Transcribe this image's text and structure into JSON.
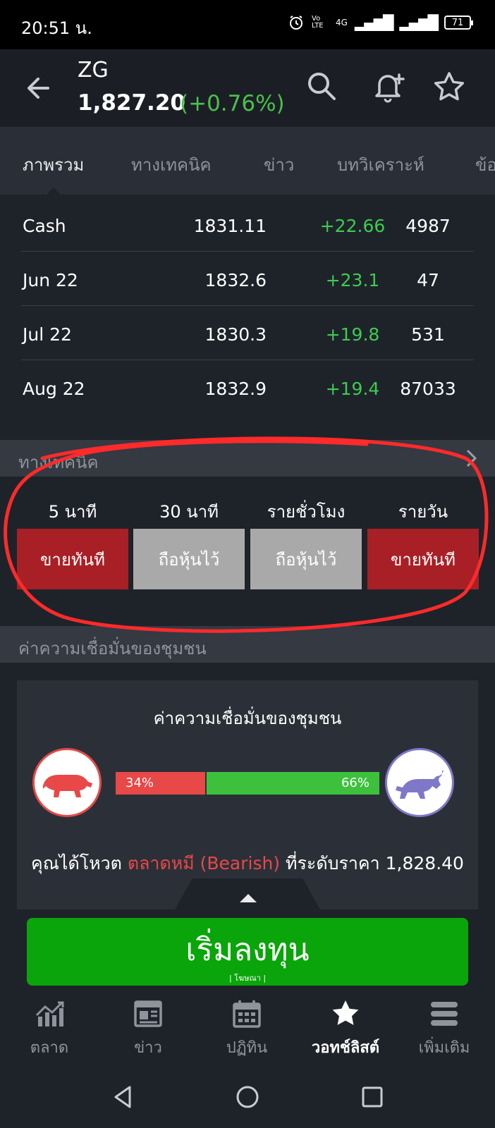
{
  "status_bar": {
    "time": "20:51 น.",
    "network": "4G",
    "volte": "Vo LTE",
    "battery": "71"
  },
  "header": {
    "symbol": "ZG",
    "price": "1,827.20",
    "change": "(+0.76%)"
  },
  "tabs": [
    "ภาพรวม",
    "ทางเทคนิค",
    "ข่าว",
    "บทวิเคราะห์",
    "ข้อ"
  ],
  "futures": [
    {
      "name": "Cash",
      "last": "1831.11",
      "change": "+22.66",
      "volume": "4987"
    },
    {
      "name": "Jun 22",
      "last": "1832.6",
      "change": "+23.1",
      "volume": "47"
    },
    {
      "name": "Jul 22",
      "last": "1830.3",
      "change": "+19.8",
      "volume": "531"
    },
    {
      "name": "Aug 22",
      "last": "1832.9",
      "change": "+19.4",
      "volume": "87033"
    }
  ],
  "technical": {
    "title": "ทางเทคนิค",
    "timeframes": [
      {
        "label": "5 นาที",
        "signal": "ขายทันที",
        "type": "sell"
      },
      {
        "label": "30 นาที",
        "signal": "ถือหุ้นไว้",
        "type": "neutral"
      },
      {
        "label": "รายชั่วโมง",
        "signal": "ถือหุ้นไว้",
        "type": "neutral"
      },
      {
        "label": "รายวัน",
        "signal": "ขายทันที",
        "type": "sell"
      }
    ]
  },
  "sentiment": {
    "section_title": "ค่าความเชื่อมั่นของชุมชน",
    "card_title": "ค่าความเชื่อมั่นของชุมชน",
    "bearish_pct": "34%",
    "bullish_pct": "66%",
    "bearish_fraction": 0.34,
    "vote_prefix": "คุณได้โหวต",
    "vote_choice": "ตลาดหมี (Bearish)",
    "vote_suffix": "ที่ระดับราคา 1,828.40"
  },
  "cta": {
    "label": "เริ่มลงทุน",
    "ad": "| โฆษณา |"
  },
  "bottom_nav": [
    "ตลาด",
    "ข่าว",
    "ปฏิทิน",
    "วอทช์ลิสต์",
    "เพิ่มเติม"
  ],
  "colors": {
    "up": "#3ecb4f",
    "sell": "#a82026",
    "neutral": "#a9a9a9",
    "bear": "#e84848",
    "bull": "#3dc13d",
    "cta": "#0aa50a",
    "annotation": "#ff2a2a"
  }
}
